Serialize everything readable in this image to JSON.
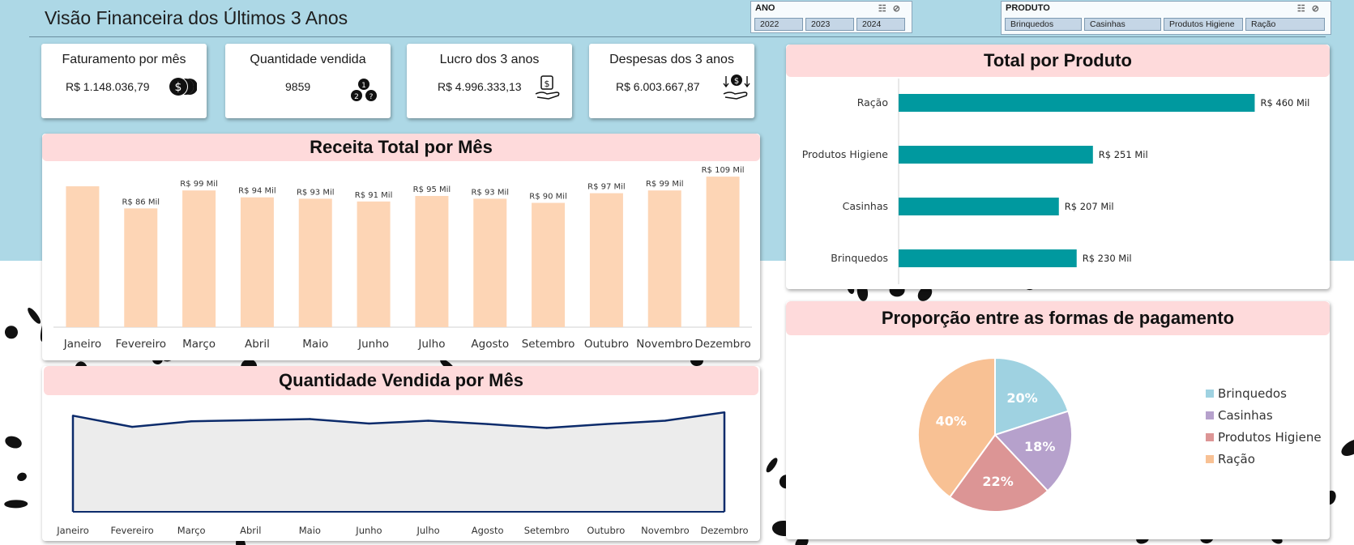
{
  "title": "Visão Financeira dos Últimos 3 Anos",
  "slicers": {
    "ano": {
      "header": "ANO",
      "items": [
        "2022",
        "2023",
        "2024"
      ]
    },
    "produto": {
      "header": "PRODUTO",
      "items": [
        "Brinquedos",
        "Casinhas",
        "Produtos Higiene",
        "Ração"
      ]
    }
  },
  "kpis": [
    {
      "title": "Faturamento por mês",
      "value": "R$ 1.148.036,79",
      "icon": "coins-icon"
    },
    {
      "title": "Quantidade vendida",
      "value": "9859",
      "icon": "numbered-balls-icon"
    },
    {
      "title": "Lucro dos 3 anos",
      "value": "R$ 4.996.333,13",
      "icon": "hand-money-icon"
    },
    {
      "title": "Despesas dos 3 anos",
      "value": "R$ 6.003.667,87",
      "icon": "hand-money-down-icon"
    }
  ],
  "colors": {
    "bar_monthly": "#fdd5b5",
    "bar_product": "#00999f",
    "panel_header": "#fedadb",
    "background_top": "#add8e6",
    "line": "#0c2b6b",
    "area": "#ececec",
    "pie": [
      "#9fd2e1",
      "#b6a1cc",
      "#dc9595",
      "#f8c194"
    ]
  },
  "chart_data": [
    {
      "id": "receita",
      "type": "bar",
      "title": "Receita Total por Mês",
      "categories": [
        "Janeiro",
        "Fevereiro",
        "Março",
        "Abril",
        "Maio",
        "Junho",
        "Julho",
        "Agosto",
        "Setembro",
        "Outubro",
        "Novembro",
        "Dezembro"
      ],
      "values": [
        102,
        86,
        99,
        94,
        93,
        91,
        95,
        93,
        90,
        97,
        99,
        109
      ],
      "data_labels": [
        "",
        "R$ 86 Mil",
        "R$ 99 Mil",
        "R$ 94 Mil",
        "R$ 93 Mil",
        "R$ 91 Mil",
        "R$ 95 Mil",
        "R$ 93 Mil",
        "R$ 90 Mil",
        "R$ 97 Mil",
        "R$ 99 Mil",
        "R$ 109 Mil"
      ],
      "ylim": [
        0,
        112
      ],
      "grid": false
    },
    {
      "id": "quantidade",
      "type": "area",
      "title": "Quantidade Vendida por Mês",
      "categories": [
        "Janeiro",
        "Fevereiro",
        "Março",
        "Abril",
        "Maio",
        "Junho",
        "Julho",
        "Agosto",
        "Setembro",
        "Outubro",
        "Novembro",
        "Dezembro"
      ],
      "values": [
        860,
        760,
        810,
        820,
        830,
        790,
        815,
        785,
        750,
        785,
        815,
        890
      ],
      "ylim": [
        0,
        1000
      ],
      "grid": false
    },
    {
      "id": "produto",
      "type": "bar",
      "orientation": "horizontal",
      "title": "Total por Produto",
      "categories": [
        "Ração",
        "Produtos Higiene",
        "Casinhas",
        "Brinquedos"
      ],
      "values": [
        460,
        251,
        207,
        230
      ],
      "data_labels": [
        "R$ 460 Mil",
        "R$ 251 Mil",
        "R$ 207 Mil",
        "R$ 230 Mil"
      ],
      "xlim": [
        0,
        560
      ],
      "grid": false
    },
    {
      "id": "pagamento",
      "type": "pie",
      "title": "Proporção entre as formas de pagamento",
      "categories": [
        "Brinquedos",
        "Casinhas",
        "Produtos Higiene",
        "Ração"
      ],
      "values": [
        20,
        18,
        22,
        40
      ],
      "data_labels": [
        "20%",
        "18%",
        "22%",
        "40%"
      ],
      "legend": "right"
    }
  ]
}
